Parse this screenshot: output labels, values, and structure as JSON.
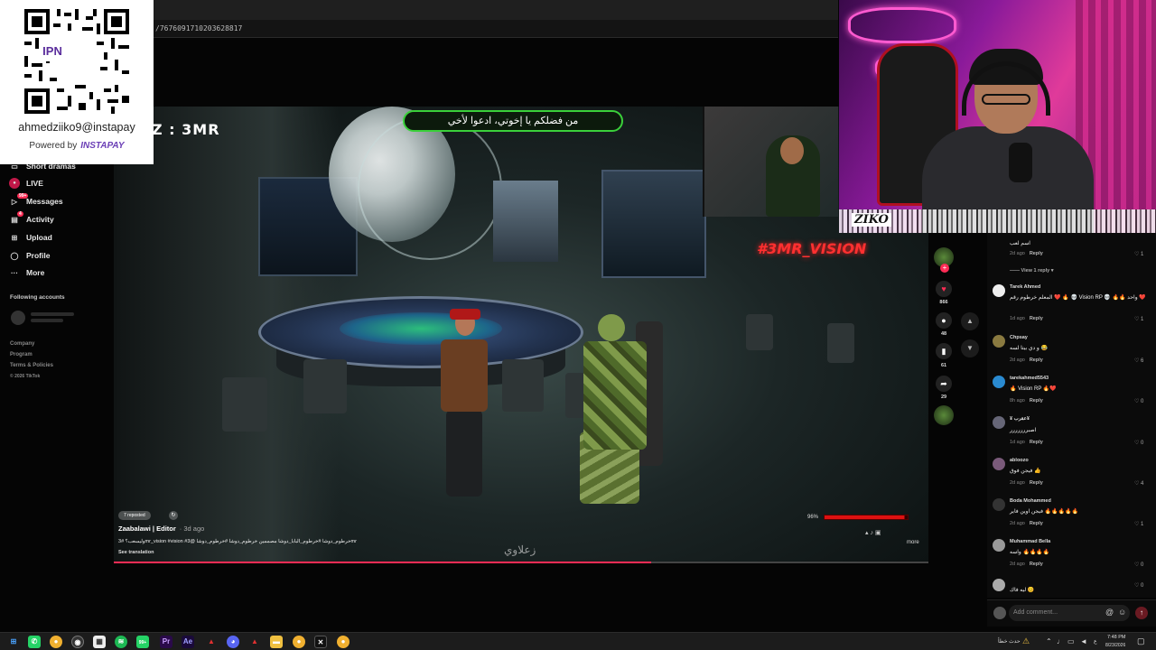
{
  "browser": {
    "url_fragment": "/7676091710203628817"
  },
  "donation": {
    "qr_logo": "IPN",
    "handle": "ahmedziiko9@instapay",
    "powered_by": "Powered by",
    "brand": "INSTAPAY"
  },
  "sidebar": {
    "items": [
      {
        "label": "Short dramas",
        "icon": "film-icon"
      },
      {
        "label": "LIVE",
        "icon": "live-icon"
      },
      {
        "label": "Messages",
        "icon": "message-icon",
        "badge": "99+"
      },
      {
        "label": "Activity",
        "icon": "bell-icon",
        "badge": "4"
      },
      {
        "label": "Upload",
        "icon": "plus-square-icon"
      },
      {
        "label": "Profile",
        "icon": "user-icon"
      },
      {
        "label": "More",
        "icon": "more-icon"
      }
    ],
    "following_heading": "Following accounts",
    "footer": [
      "Company",
      "Program",
      "Terms & Policies",
      "© 2026 TikTok"
    ]
  },
  "video": {
    "streamer_tag": "Z : 3MR",
    "banner_text": "من فضلكم يا إخوتي، ادعوا لأخي",
    "vision_tag": "#3MR_VISION",
    "watermark": "زعلاوي",
    "health_label": "96%",
    "health_percent": 96,
    "reposts_label": "7 reposted",
    "author": "Zaabalawi | Editor",
    "age": "· 3d ago",
    "caption": "وليسعب؟ #3mr_vision #vision #خرطوم_دوشا #خرطوم_البابا_دوشا مصممين خرطوم_دوشا #خرطوم_دوشا @3mr",
    "see_translation": "See translation",
    "more_label": "more",
    "progress_fraction": 0.66
  },
  "rail": {
    "likes": "866",
    "comments": "48",
    "saves": "61",
    "shares": "29"
  },
  "webcam": {
    "logo": "ZIKO"
  },
  "comments": [
    {
      "name": "",
      "text": "اسم لعب",
      "age": "2d ago",
      "reply": "Reply",
      "likes": "1",
      "view_reply": "View 1 reply"
    },
    {
      "name": "Tarek Ahmed",
      "text": "المعلم خرطوم رقم ❤️ 🔥 💀 Vision RP 💀 🔥🔥 واحد ❤️",
      "age": "1d ago",
      "reply": "Reply",
      "likes": "1"
    },
    {
      "name": "Chpsay",
      "text": "و دي بيتا لسه 😂",
      "age": "2d ago",
      "reply": "Reply",
      "likes": "6"
    },
    {
      "name": "tarekahmed5543",
      "text": "🔥 Vision RP 🔥❤️",
      "age": "8h ago",
      "reply": "Reply",
      "likes": "0"
    },
    {
      "name": "¥ عقرب¥",
      "text": "اصبررررررر",
      "age": "1d ago",
      "reply": "Reply",
      "likes": "0"
    },
    {
      "name": "abloozo",
      "text": "فيجن فوق 👍",
      "age": "2d ago",
      "reply": "Reply",
      "likes": "4"
    },
    {
      "name": "Boda Mohammed",
      "text": "فيجن اوين فاير 🔥🔥🔥🔥🔥",
      "age": "2d ago",
      "reply": "Reply",
      "likes": "1"
    },
    {
      "name": "Muhammad Bella",
      "text": "واسه 🔥🔥🔥🔥",
      "age": "2d ago",
      "reply": "Reply",
      "likes": "0"
    },
    {
      "name": "",
      "text": "ليه فاك 😊",
      "age": "",
      "reply": "",
      "likes": "0"
    }
  ],
  "add_comment": {
    "placeholder": "Add comment..."
  },
  "taskbar": {
    "news": "حدث خطأ",
    "lang": "ع",
    "time": "7:48 PM",
    "date": "8/23/2026",
    "apps": [
      "whatsapp",
      "chrome",
      "obs",
      "calendar",
      "spotify",
      "whatsapp-business",
      "premiere",
      "after-effects",
      "autodesk",
      "discord",
      "autodesk-2",
      "files",
      "chrome-2",
      "capcut",
      "chrome-3"
    ],
    "badge_99": "99+"
  }
}
